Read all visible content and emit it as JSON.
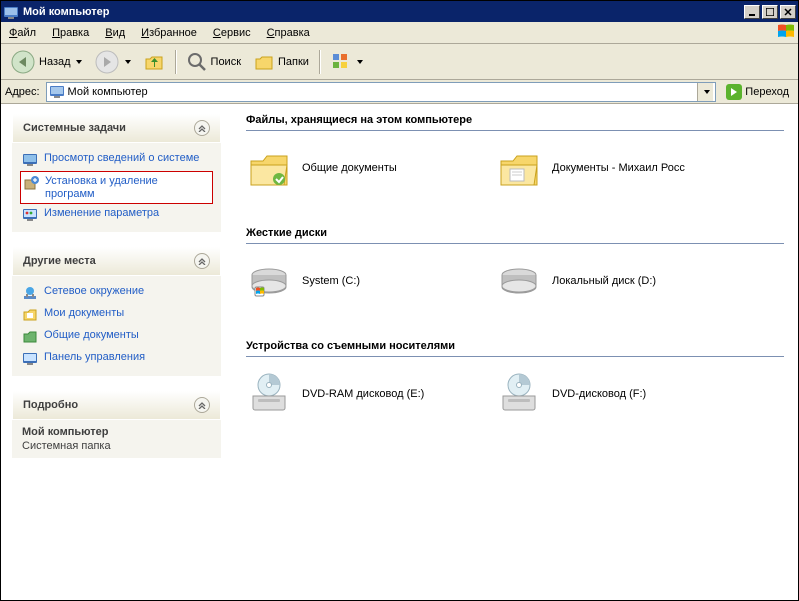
{
  "window": {
    "title": "Мой компьютер"
  },
  "menu": {
    "file": "Файл",
    "edit": "Правка",
    "view": "Вид",
    "favorites": "Избранное",
    "tools": "Сервис",
    "help": "Справка"
  },
  "toolbar": {
    "back": "Назад",
    "forward": "",
    "search": "Поиск",
    "folders": "Папки"
  },
  "addressbar": {
    "label": "Адрес:",
    "value": "Мой компьютер",
    "go": "Переход"
  },
  "sidebar": {
    "systasks": {
      "title": "Системные задачи",
      "items": [
        {
          "label": "Просмотр сведений о системе"
        },
        {
          "label": "Установка и удаление программ"
        },
        {
          "label": "Изменение параметра"
        }
      ]
    },
    "otherplaces": {
      "title": "Другие места",
      "items": [
        {
          "label": "Сетевое окружение"
        },
        {
          "label": "Мои документы"
        },
        {
          "label": "Общие документы"
        },
        {
          "label": "Панель управления"
        }
      ]
    },
    "details": {
      "title": "Подробно",
      "name": "Мой компьютер",
      "type": "Системная папка"
    }
  },
  "content": {
    "groups": [
      {
        "title": "Файлы, хранящиеся на этом компьютере",
        "items": [
          {
            "label": "Общие документы"
          },
          {
            "label": "Документы - Михаил Росс"
          }
        ]
      },
      {
        "title": "Жесткие диски",
        "items": [
          {
            "label": "System (C:)"
          },
          {
            "label": "Локальный диск (D:)"
          }
        ]
      },
      {
        "title": "Устройства со съемными носителями",
        "items": [
          {
            "label": "DVD-RAM дисковод (E:)"
          },
          {
            "label": "DVD-дисковод (F:)"
          }
        ]
      }
    ]
  }
}
